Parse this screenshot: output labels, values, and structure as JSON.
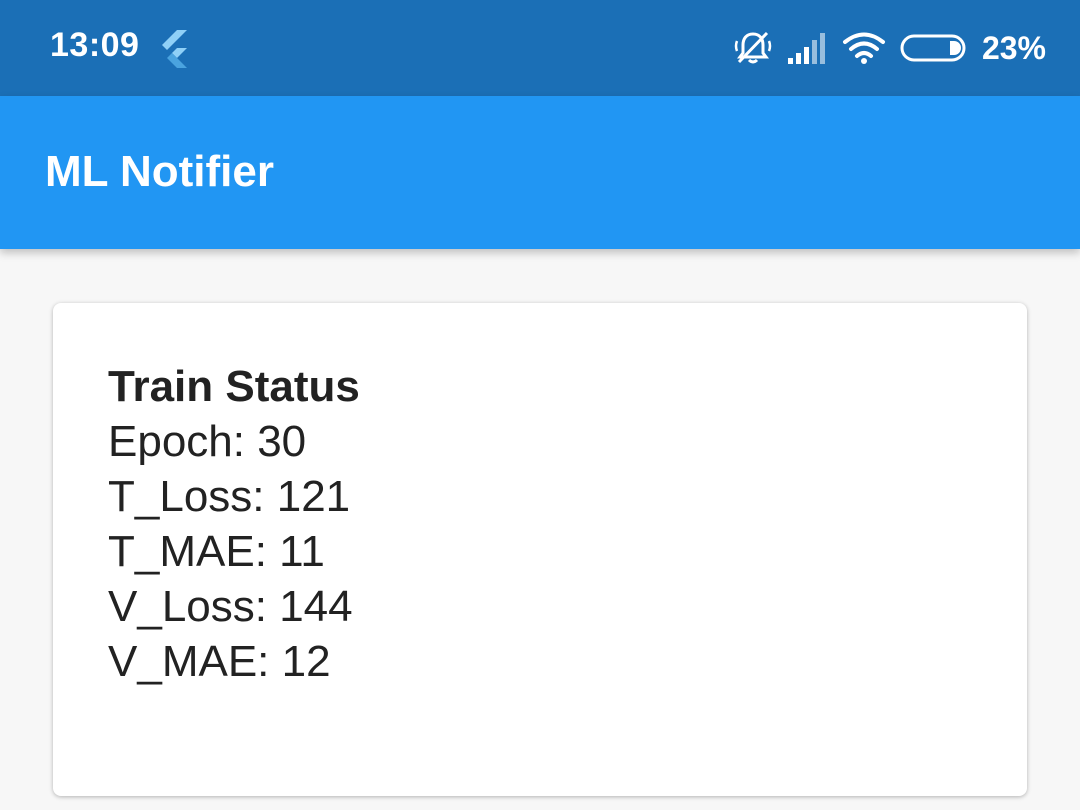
{
  "status_bar": {
    "time": "13:09",
    "battery_percent": "23%",
    "icons": [
      "flutter-icon",
      "silent-bell-icon",
      "signal-icon",
      "wifi-icon",
      "battery-icon"
    ],
    "background_color": "#1b6fb6"
  },
  "app_bar": {
    "title": "ML Notifier",
    "background_color": "#2196f3"
  },
  "card": {
    "title": "Train Status",
    "lines": [
      "Epoch: 30",
      "T_Loss: 121",
      "T_MAE: 11",
      "V_Loss: 144",
      "V_MAE: 12"
    ]
  }
}
